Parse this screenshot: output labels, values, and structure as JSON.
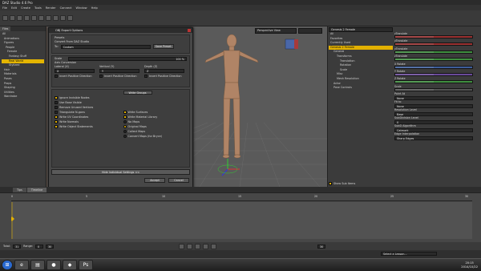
{
  "app": {
    "title": "DAZ Studio 4.6 Pro"
  },
  "menu": [
    "File",
    "Edit",
    "Create",
    "Tools",
    "Render",
    "Connect",
    "Window",
    "Help"
  ],
  "left_panel": {
    "tabs": [
      "Files",
      "Favorites"
    ],
    "tree": [
      "All",
      "Animations",
      "Figures",
      "People",
      "Female",
      "Fantasy Stuff",
      "Real World",
      "Stylized",
      "Hair",
      "Materials",
      "Poses",
      "Props",
      "Shaping",
      "Utilities",
      "Wardrobe"
    ],
    "selected": "Real World"
  },
  "viewport": {
    "camera": "Perspective View",
    "field2": ""
  },
  "dialog": {
    "title": "OBJ Export Options",
    "section_presets": "Presets",
    "convert_from": "Convert From DAZ Studio",
    "to_label": "To:",
    "to_value": "Custom",
    "save_preset": "Save Preset",
    "scale_label": "Scale",
    "scale_value": "100 %",
    "axis_title": "Axis Conversion",
    "lateral": "Lateral (X)",
    "vertical": "Vertical (Y)",
    "depth": "Depth (Z)",
    "axis_values": [
      "X",
      "Y",
      "Z"
    ],
    "invert_positive": "Invert Positive Direction",
    "write_groups": "Write Groups",
    "left_checks": [
      {
        "label": "Ignore Invisible Nodes",
        "on": true
      },
      {
        "label": "Use Base Visible",
        "on": false
      },
      {
        "label": "Remove Unused Vertices",
        "on": false
      },
      {
        "label": "Triangulate N-gons",
        "on": false
      },
      {
        "label": "Write UV Coordinates",
        "on": true
      },
      {
        "label": "Write Normals",
        "on": true
      },
      {
        "label": "Write Object Statements",
        "on": true
      }
    ],
    "right_checks": [
      {
        "label": "Write Surfaces",
        "on": true
      },
      {
        "label": "Write Material Library",
        "on": true
      },
      {
        "label": "No Maps",
        "on": false
      },
      {
        "label": "Original Maps",
        "on": true
      },
      {
        "label": "Collect Maps",
        "on": false
      },
      {
        "label": "Convert Maps (for Bryce)",
        "on": false
      }
    ],
    "hide_advanced": "Hide Individual Settings <<",
    "accept": "Accept",
    "cancel": "Cancel"
  },
  "right_panel": {
    "figure_dropdown": "Genesis 2 Female",
    "tree": [
      "All",
      "Favorites",
      "Currently Used",
      "Genesis 2 Female",
      "General",
      "Transforms",
      "Translation",
      "Rotation",
      "Scale",
      "Misc",
      "Mesh Resolution",
      "Actor",
      "Pose Controls"
    ],
    "selected": "Genesis 2 Female",
    "params": [
      {
        "label": "zTranslate",
        "color": "#9a3030"
      },
      {
        "label": "yTranslate",
        "color": "#9a3030"
      },
      {
        "label": "yTranslate",
        "color": "#3f8f3f"
      },
      {
        "label": "zTranslate",
        "color": "#3f8f3f"
      },
      {
        "label": "X Rotate",
        "color": "#3e5e9a"
      },
      {
        "label": "Y Rotate",
        "color": "#6a4a9a"
      },
      {
        "label": "Z Rotate",
        "color": "#3f8f3f"
      },
      {
        "label": "Scale",
        "color": "#555555"
      }
    ],
    "lower": [
      "Point At",
      "None",
      "Fit to",
      "None",
      "Resolution Level",
      "Base",
      "SubDivision Level",
      "0",
      "SubD Algorithm",
      "Catmark",
      "Edge Interpolation",
      "Sharp Edges"
    ],
    "show_sub_items": "Show Sub Items"
  },
  "bottom_tabs": [
    "Tips",
    "Timeline"
  ],
  "timeline": {
    "ticks": [
      "0",
      "5",
      "10",
      "15",
      "20",
      "25",
      "30"
    ],
    "total_label": "Total:",
    "total_value": "31",
    "range_label": "Range:",
    "range_start": "0",
    "range_end": "30",
    "frame_label": "Frame",
    "fps_value": "30",
    "lesson": "Select a Lesson..."
  },
  "taskbar": {
    "time": "20:15",
    "date": "2014/10/22"
  }
}
